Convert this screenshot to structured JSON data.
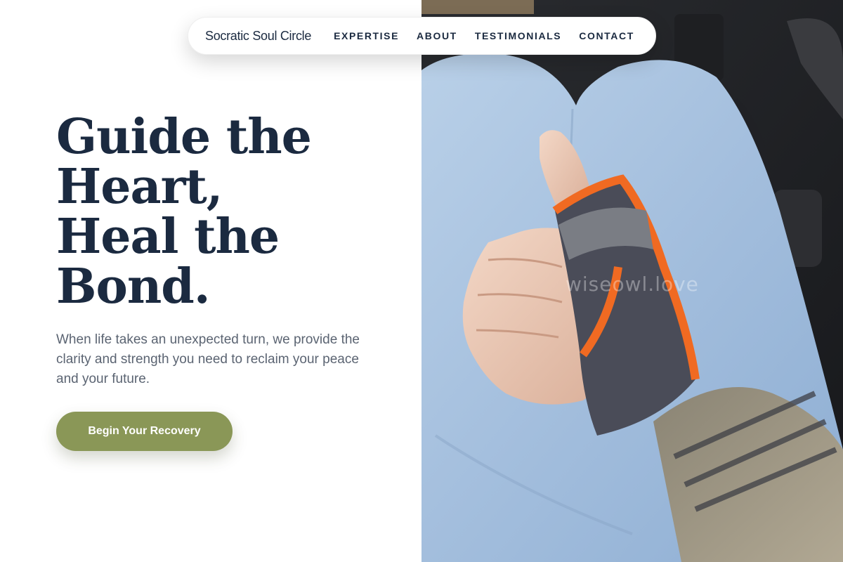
{
  "nav": {
    "brand": "Socratic Soul Circle",
    "links": [
      {
        "label": "EXPERTISE"
      },
      {
        "label": "ABOUT"
      },
      {
        "label": "TESTIMONIALS"
      },
      {
        "label": "CONTACT"
      }
    ]
  },
  "hero": {
    "title_lines": [
      "Guide the",
      "Heart,",
      "Heal the",
      "Bond."
    ],
    "subtitle": "When life takes an unexpected turn, we provide the clarity and strength you need to reclaim your peace and your future.",
    "cta_label": "Begin Your Recovery"
  },
  "photo": {
    "watermark": "wiseowl.love"
  },
  "colors": {
    "heading": "#1b2a40",
    "body_text": "#5b6472",
    "cta_background": "#8a9757",
    "cta_text": "#ffffff",
    "background": "#ffffff"
  }
}
